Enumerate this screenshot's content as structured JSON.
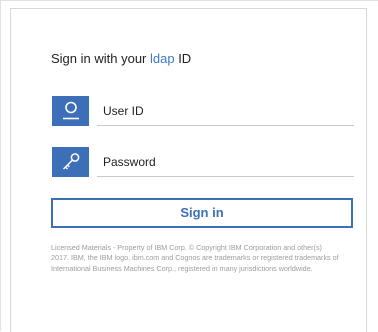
{
  "signin": {
    "heading_prefix": "Sign in with your ",
    "heading_accent": "ldap",
    "heading_suffix": " ID",
    "user_placeholder": "User ID",
    "password_placeholder": "Password",
    "button_label": "Sign in"
  },
  "legal_text": "Licensed Materials - Property of IBM Corp. © Copyright IBM Corporation and other(s) 2017. IBM, the IBM logo, ibm.com and Cognos are trademarks or registered trademarks of International Business Machines Corp., registered in many jurisdictions worldwide.",
  "colors": {
    "accent": "#3d6fb8",
    "link": "#3f7ac6"
  },
  "icons": {
    "user": "user-icon",
    "password": "key-icon"
  }
}
